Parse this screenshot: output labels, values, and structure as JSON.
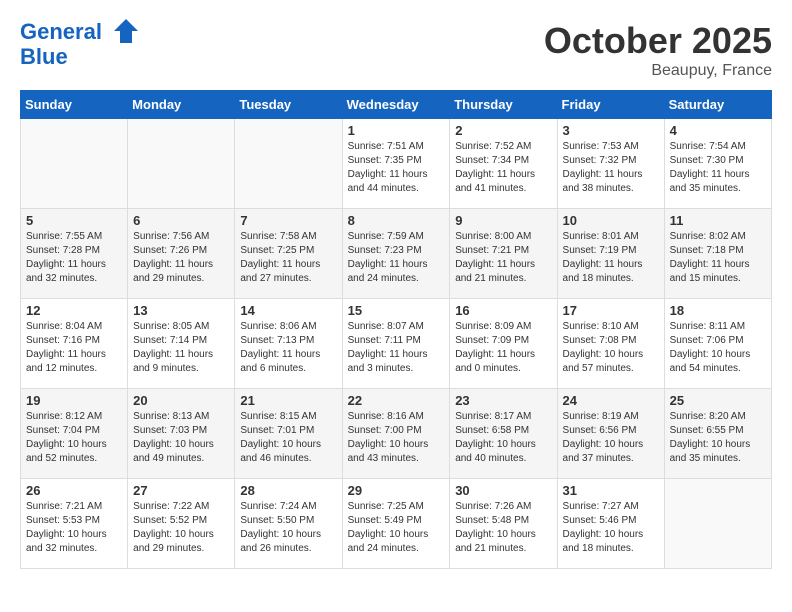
{
  "logo": {
    "line1": "General",
    "line2": "Blue"
  },
  "header": {
    "month": "October 2025",
    "location": "Beaupuy, France"
  },
  "weekdays": [
    "Sunday",
    "Monday",
    "Tuesday",
    "Wednesday",
    "Thursday",
    "Friday",
    "Saturday"
  ],
  "weeks": [
    [
      {
        "day": "",
        "info": ""
      },
      {
        "day": "",
        "info": ""
      },
      {
        "day": "",
        "info": ""
      },
      {
        "day": "1",
        "info": "Sunrise: 7:51 AM\nSunset: 7:35 PM\nDaylight: 11 hours\nand 44 minutes."
      },
      {
        "day": "2",
        "info": "Sunrise: 7:52 AM\nSunset: 7:34 PM\nDaylight: 11 hours\nand 41 minutes."
      },
      {
        "day": "3",
        "info": "Sunrise: 7:53 AM\nSunset: 7:32 PM\nDaylight: 11 hours\nand 38 minutes."
      },
      {
        "day": "4",
        "info": "Sunrise: 7:54 AM\nSunset: 7:30 PM\nDaylight: 11 hours\nand 35 minutes."
      }
    ],
    [
      {
        "day": "5",
        "info": "Sunrise: 7:55 AM\nSunset: 7:28 PM\nDaylight: 11 hours\nand 32 minutes."
      },
      {
        "day": "6",
        "info": "Sunrise: 7:56 AM\nSunset: 7:26 PM\nDaylight: 11 hours\nand 29 minutes."
      },
      {
        "day": "7",
        "info": "Sunrise: 7:58 AM\nSunset: 7:25 PM\nDaylight: 11 hours\nand 27 minutes."
      },
      {
        "day": "8",
        "info": "Sunrise: 7:59 AM\nSunset: 7:23 PM\nDaylight: 11 hours\nand 24 minutes."
      },
      {
        "day": "9",
        "info": "Sunrise: 8:00 AM\nSunset: 7:21 PM\nDaylight: 11 hours\nand 21 minutes."
      },
      {
        "day": "10",
        "info": "Sunrise: 8:01 AM\nSunset: 7:19 PM\nDaylight: 11 hours\nand 18 minutes."
      },
      {
        "day": "11",
        "info": "Sunrise: 8:02 AM\nSunset: 7:18 PM\nDaylight: 11 hours\nand 15 minutes."
      }
    ],
    [
      {
        "day": "12",
        "info": "Sunrise: 8:04 AM\nSunset: 7:16 PM\nDaylight: 11 hours\nand 12 minutes."
      },
      {
        "day": "13",
        "info": "Sunrise: 8:05 AM\nSunset: 7:14 PM\nDaylight: 11 hours\nand 9 minutes."
      },
      {
        "day": "14",
        "info": "Sunrise: 8:06 AM\nSunset: 7:13 PM\nDaylight: 11 hours\nand 6 minutes."
      },
      {
        "day": "15",
        "info": "Sunrise: 8:07 AM\nSunset: 7:11 PM\nDaylight: 11 hours\nand 3 minutes."
      },
      {
        "day": "16",
        "info": "Sunrise: 8:09 AM\nSunset: 7:09 PM\nDaylight: 11 hours\nand 0 minutes."
      },
      {
        "day": "17",
        "info": "Sunrise: 8:10 AM\nSunset: 7:08 PM\nDaylight: 10 hours\nand 57 minutes."
      },
      {
        "day": "18",
        "info": "Sunrise: 8:11 AM\nSunset: 7:06 PM\nDaylight: 10 hours\nand 54 minutes."
      }
    ],
    [
      {
        "day": "19",
        "info": "Sunrise: 8:12 AM\nSunset: 7:04 PM\nDaylight: 10 hours\nand 52 minutes."
      },
      {
        "day": "20",
        "info": "Sunrise: 8:13 AM\nSunset: 7:03 PM\nDaylight: 10 hours\nand 49 minutes."
      },
      {
        "day": "21",
        "info": "Sunrise: 8:15 AM\nSunset: 7:01 PM\nDaylight: 10 hours\nand 46 minutes."
      },
      {
        "day": "22",
        "info": "Sunrise: 8:16 AM\nSunset: 7:00 PM\nDaylight: 10 hours\nand 43 minutes."
      },
      {
        "day": "23",
        "info": "Sunrise: 8:17 AM\nSunset: 6:58 PM\nDaylight: 10 hours\nand 40 minutes."
      },
      {
        "day": "24",
        "info": "Sunrise: 8:19 AM\nSunset: 6:56 PM\nDaylight: 10 hours\nand 37 minutes."
      },
      {
        "day": "25",
        "info": "Sunrise: 8:20 AM\nSunset: 6:55 PM\nDaylight: 10 hours\nand 35 minutes."
      }
    ],
    [
      {
        "day": "26",
        "info": "Sunrise: 7:21 AM\nSunset: 5:53 PM\nDaylight: 10 hours\nand 32 minutes."
      },
      {
        "day": "27",
        "info": "Sunrise: 7:22 AM\nSunset: 5:52 PM\nDaylight: 10 hours\nand 29 minutes."
      },
      {
        "day": "28",
        "info": "Sunrise: 7:24 AM\nSunset: 5:50 PM\nDaylight: 10 hours\nand 26 minutes."
      },
      {
        "day": "29",
        "info": "Sunrise: 7:25 AM\nSunset: 5:49 PM\nDaylight: 10 hours\nand 24 minutes."
      },
      {
        "day": "30",
        "info": "Sunrise: 7:26 AM\nSunset: 5:48 PM\nDaylight: 10 hours\nand 21 minutes."
      },
      {
        "day": "31",
        "info": "Sunrise: 7:27 AM\nSunset: 5:46 PM\nDaylight: 10 hours\nand 18 minutes."
      },
      {
        "day": "",
        "info": ""
      }
    ]
  ]
}
